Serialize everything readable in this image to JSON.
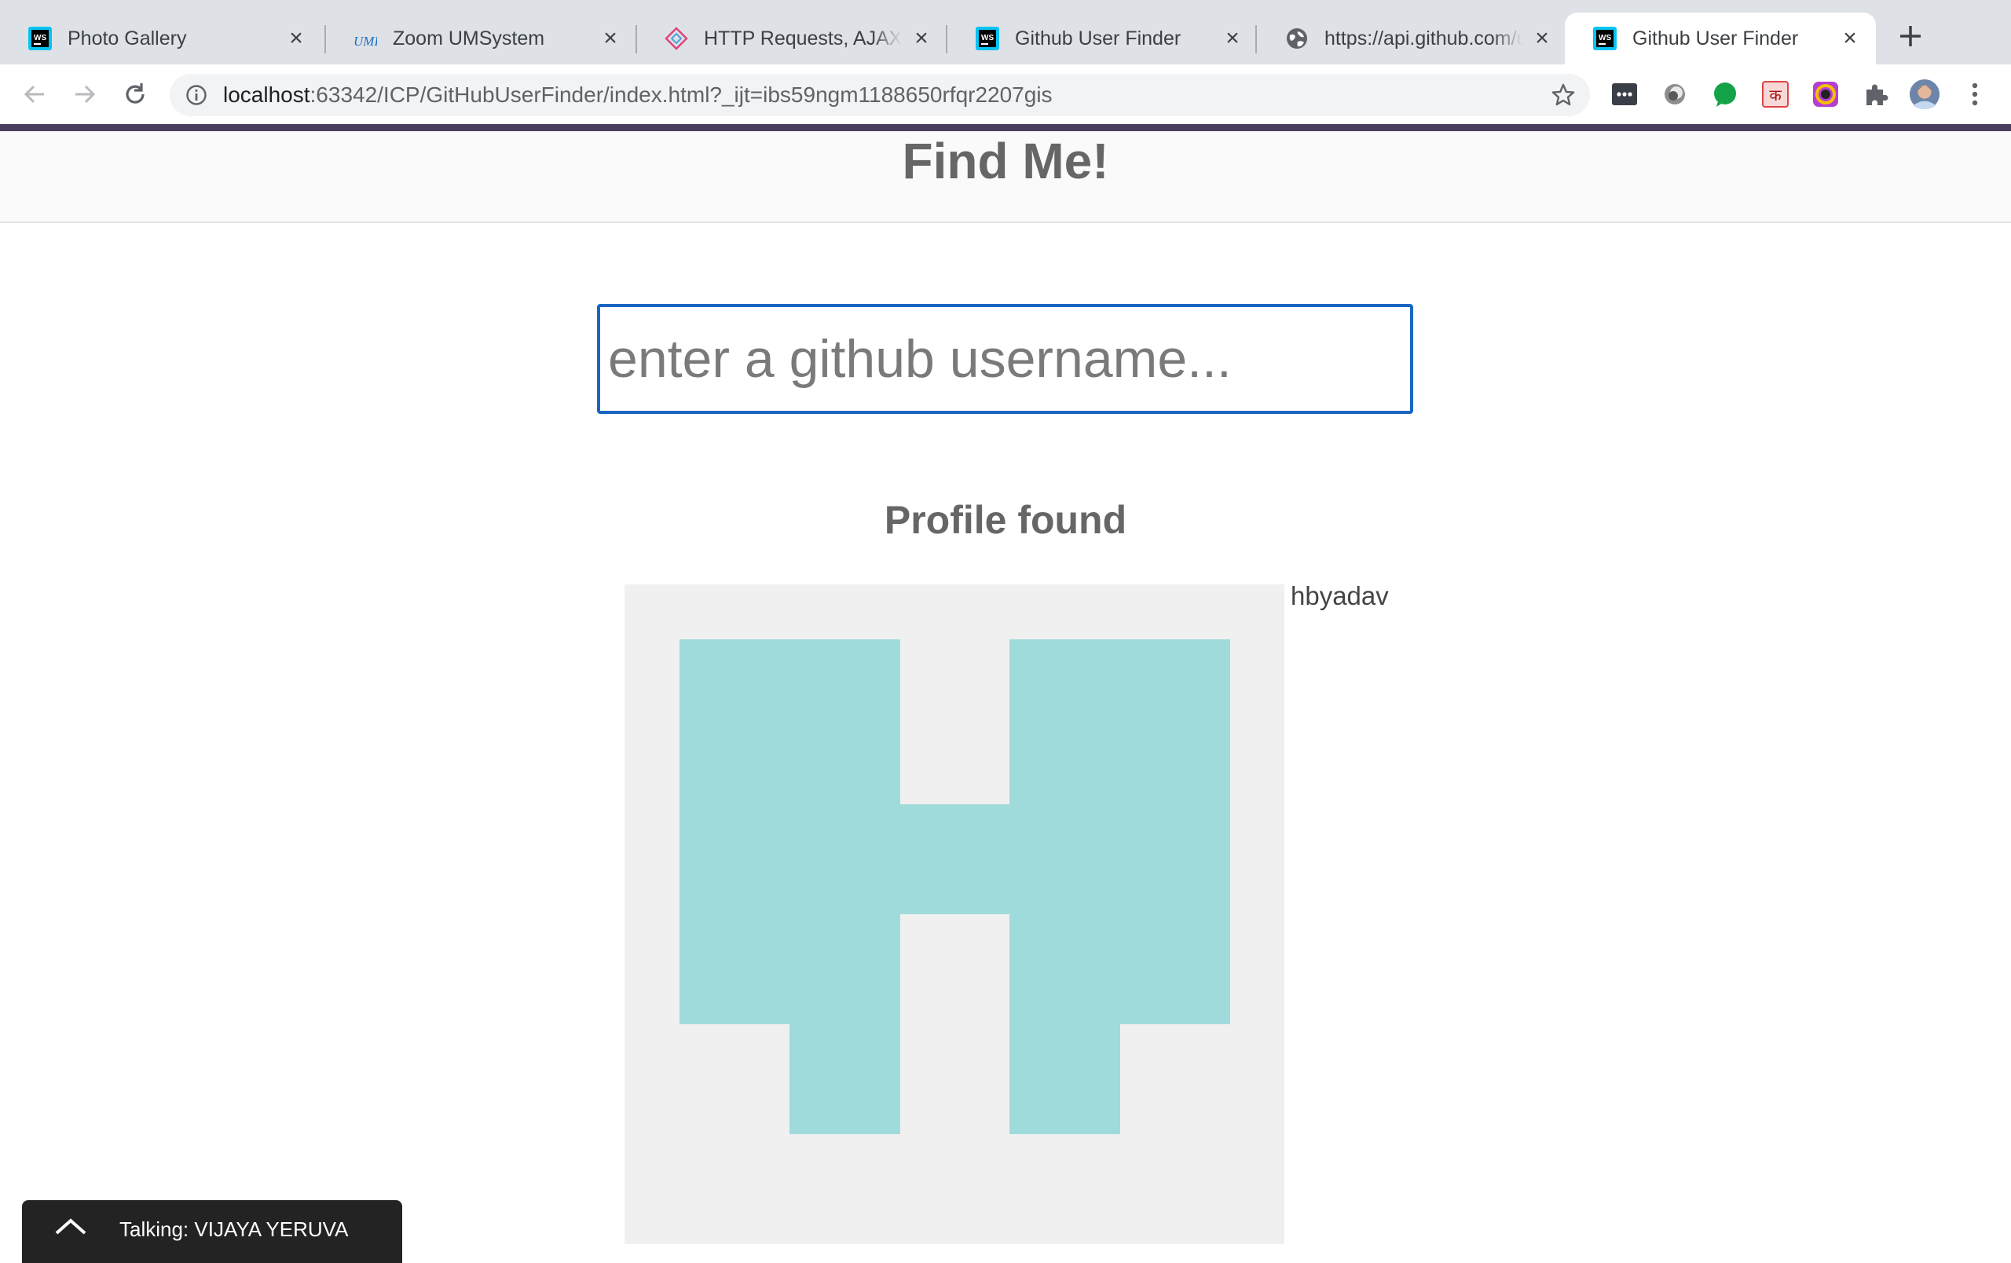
{
  "browser": {
    "tabs": [
      {
        "title": "Photo Gallery",
        "favicon": "webstorm-icon"
      },
      {
        "title": "Zoom UMSystem",
        "favicon": "umkc-icon"
      },
      {
        "title": "HTTP Requests, AJAX a",
        "favicon": "diamond-icon"
      },
      {
        "title": "Github User Finder",
        "favicon": "webstorm-icon"
      },
      {
        "title": "https://api.github.com/u",
        "favicon": "globe-icon"
      },
      {
        "title": "Github User Finder",
        "favicon": "webstorm-icon",
        "active": true
      }
    ],
    "address": {
      "host": "localhost",
      "rest": ":63342/ICP/GitHubUserFinder/index.html?_ijt=ibs59ngm1188650rfqr2207gis"
    }
  },
  "page": {
    "title": "Find Me!",
    "search": {
      "placeholder": "enter a github username...",
      "value": ""
    },
    "profile_heading": "Profile found",
    "username": "hbyadav"
  },
  "zoom_notification": {
    "text": "Talking: VIJAYA YERUVA"
  },
  "colors": {
    "accent_bar": "#4b3f60",
    "avatar_fill": "#a0dbdb",
    "avatar_bg": "#f0f0f0",
    "input_border": "#1a66c4"
  }
}
